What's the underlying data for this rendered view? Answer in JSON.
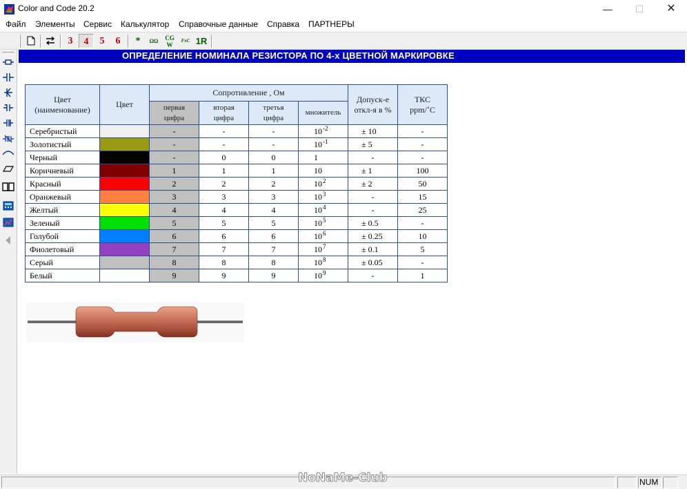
{
  "window": {
    "title": "Color and Code 20.2",
    "minimize_glyph": "—",
    "maximize_glyph": "☐",
    "close_glyph": "✕"
  },
  "menu": {
    "items": [
      "Файл",
      "Элементы",
      "Сервис",
      "Калькулятор",
      "Справочные данные",
      "Справка",
      "ПАРТНЕРЫ"
    ]
  },
  "toolbar": {
    "band_buttons": [
      "3",
      "4",
      "5",
      "6"
    ],
    "active_band": "4",
    "star_label": "*",
    "smd_label": "ΩΩ",
    "cgw_label": "CG W",
    "fxc_label": "FxC",
    "ir_label": "1R",
    "icons": [
      "new-file-icon",
      "swap-arrows-icon"
    ]
  },
  "left_toolbar": {
    "icons": [
      "resistor-icon",
      "capacitor-icon",
      "diode-icon",
      "polar-capacitor-icon",
      "electrolytic-icon",
      "varistor-icon",
      "inductor-icon",
      "fuse-icon",
      "book-icon",
      "calculator-icon",
      "chart-icon",
      "arrow-left-icon"
    ]
  },
  "header": {
    "text": "ОПРЕДЕЛЕНИЕ НОМИНАЛА РЕЗИСТОРА ПО 4-х ЦВЕТНОЙ МАРКИРОВКЕ",
    "color": "#0000c0"
  },
  "table": {
    "head": {
      "color_name_1": "Цвет",
      "color_name_2": "(наименование)",
      "color": "Цвет",
      "resistance": "Сопротивление , Ом",
      "digit1_1": "первая",
      "digit1_2": "цифра",
      "digit2_1": "вторая",
      "digit2_2": "цифра",
      "digit3_1": "третья",
      "digit3_2": "цифра",
      "multiplier": "множитель",
      "tolerance_1": "Допуск-е",
      "tolerance_2": "откл-я в %",
      "tcr_1": "ТКС",
      "tcr_2": "ppm/˚C"
    },
    "rows": [
      {
        "name": "Серебристый",
        "swatch": "#f0f0f0",
        "d1": "-",
        "d2": "-",
        "d3": "-",
        "mult_base": "10",
        "mult_exp": "-2",
        "tol": "± 10",
        "tcr": "-"
      },
      {
        "name": "Золотистый",
        "swatch": "#999913",
        "d1": "-",
        "d2": "-",
        "d3": "-",
        "mult_base": "10",
        "mult_exp": "-1",
        "tol": "± 5",
        "tcr": "-"
      },
      {
        "name": "Черный",
        "swatch": "#000000",
        "d1": "-",
        "d2": "0",
        "d3": "0",
        "mult_base": "1",
        "mult_exp": "",
        "tol": "-",
        "tcr": "-"
      },
      {
        "name": "Коричневый",
        "swatch": "#800000",
        "d1": "1",
        "d2": "1",
        "d3": "1",
        "mult_base": "10",
        "mult_exp": "",
        "tol": "± 1",
        "tcr": "100"
      },
      {
        "name": "Красный",
        "swatch": "#ff0000",
        "d1": "2",
        "d2": "2",
        "d3": "2",
        "mult_base": "10",
        "mult_exp": "2",
        "tol": "± 2",
        "tcr": "50"
      },
      {
        "name": "Оранжевый",
        "swatch": "#ff8040",
        "d1": "3",
        "d2": "3",
        "d3": "3",
        "mult_base": "10",
        "mult_exp": "3",
        "tol": "-",
        "tcr": "15"
      },
      {
        "name": "Желтый",
        "swatch": "#ffff00",
        "d1": "4",
        "d2": "4",
        "d3": "4",
        "mult_base": "10",
        "mult_exp": "4",
        "tol": "-",
        "tcr": "25"
      },
      {
        "name": "Зеленый",
        "swatch": "#00e000",
        "d1": "5",
        "d2": "5",
        "d3": "5",
        "mult_base": "10",
        "mult_exp": "5",
        "tol": "± 0.5",
        "tcr": "-"
      },
      {
        "name": "Голубой",
        "swatch": "#0080ff",
        "d1": "6",
        "d2": "6",
        "d3": "6",
        "mult_base": "10",
        "mult_exp": "6",
        "tol": "± 0.25",
        "tcr": "10"
      },
      {
        "name": "Фиолетовый",
        "swatch": "#9040c0",
        "d1": "7",
        "d2": "7",
        "d3": "7",
        "mult_base": "10",
        "mult_exp": "7",
        "tol": "± 0.1",
        "tcr": "5"
      },
      {
        "name": "Серый",
        "swatch": "#c0c0c0",
        "d1": "8",
        "d2": "8",
        "d3": "8",
        "mult_base": "10",
        "mult_exp": "8",
        "tol": "± 0.05",
        "tcr": "-"
      },
      {
        "name": "Белый",
        "swatch": "#ffffff",
        "d1": "9",
        "d2": "9",
        "d3": "9",
        "mult_base": "10",
        "mult_exp": "9",
        "tol": "-",
        "tcr": "1"
      }
    ]
  },
  "resistor": {
    "body_color": "#c8705a",
    "lead_color": "#707070"
  },
  "status": {
    "num": "NUM",
    "watermark": "NoNaMe-Club"
  }
}
